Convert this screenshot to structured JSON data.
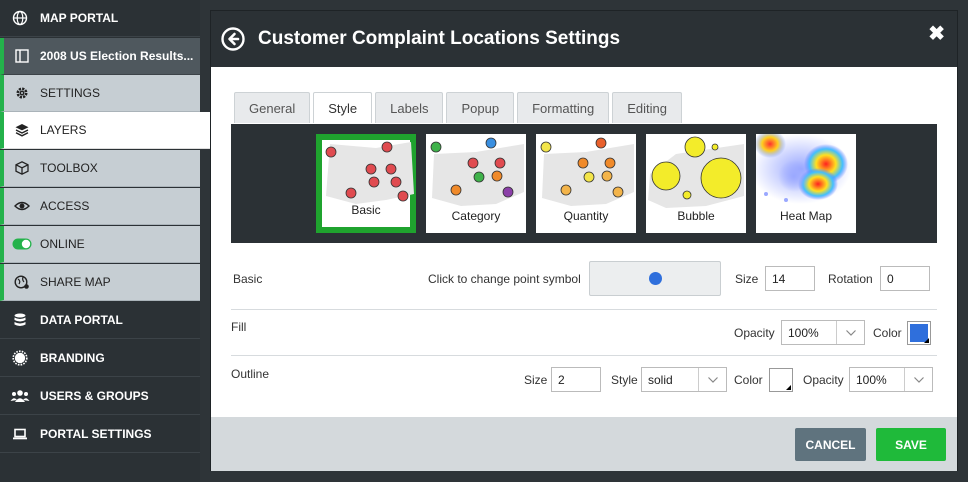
{
  "sidebar": {
    "map_portal": "MAP PORTAL",
    "layer_name": "2008 US Election Results...",
    "settings": "SETTINGS",
    "layers": "LAYERS",
    "toolbox": "TOOLBOX",
    "access": "ACCESS",
    "online": "ONLINE",
    "share_map": "SHARE MAP",
    "data_portal": "DATA PORTAL",
    "branding": "BRANDING",
    "users_groups": "USERS & GROUPS",
    "portal_settings": "PORTAL SETTINGS"
  },
  "modal": {
    "title": "Customer Complaint Locations Settings",
    "close": "✖",
    "tabs": [
      "General",
      "Style",
      "Labels",
      "Popup",
      "Formatting",
      "Editing"
    ],
    "active_tab": "Style",
    "symbol_types": [
      "Basic",
      "Category",
      "Quantity",
      "Bubble",
      "Heat Map"
    ],
    "selected_symbol_type": "Basic",
    "basic": {
      "label": "Basic",
      "point_symbol_label": "Click to change point symbol",
      "size_label": "Size",
      "size_value": "14",
      "rotation_label": "Rotation",
      "rotation_value": "0",
      "point_color": "#2f6fdc"
    },
    "fill": {
      "label": "Fill",
      "opacity_label": "Opacity",
      "opacity_value": "100%",
      "color_label": "Color",
      "color": "#2f6fdc"
    },
    "outline": {
      "label": "Outline",
      "size_label": "Size",
      "size_value": "2",
      "style_label": "Style",
      "style_value": "solid",
      "color_label": "Color",
      "color": "#ffffff",
      "opacity_label": "Opacity",
      "opacity_value": "100%"
    },
    "buttons": {
      "cancel": "CANCEL",
      "save": "SAVE"
    }
  },
  "colors": {
    "accent_green": "#1fba3a",
    "sidebar_bg": "#2b3135",
    "toggle_on": "#24b24b"
  }
}
